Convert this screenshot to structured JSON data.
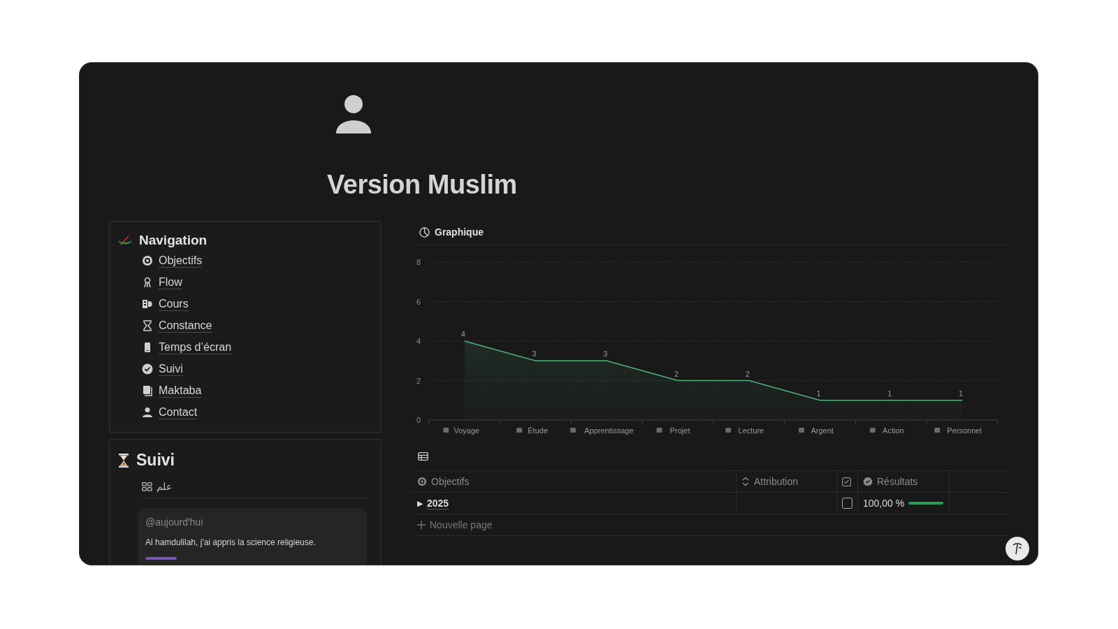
{
  "page": {
    "title": "Version Muslim"
  },
  "navigation": {
    "title": "Navigation",
    "items": [
      {
        "label": "Objectifs"
      },
      {
        "label": "Flow"
      },
      {
        "label": "Cours"
      },
      {
        "label": "Constance"
      },
      {
        "label": "Temps d’écran"
      },
      {
        "label": "Suivi"
      },
      {
        "label": "Maktaba"
      },
      {
        "label": "Contact"
      }
    ]
  },
  "suivi": {
    "title": "Suivi",
    "view_tab": "علم",
    "card": {
      "date": "@aujourd'hui",
      "text": "Al hamdulilah, j'ai appris la science religieuse."
    }
  },
  "chart": {
    "title": "Graphique",
    "chart_data": {
      "type": "area",
      "categories": [
        "Voyage",
        "Étude",
        "Apprentissage",
        "Projet",
        "Lecture",
        "Argent",
        "Action",
        "Personnel"
      ],
      "series": [
        {
          "color": "#4fb27f",
          "values": [
            4,
            3,
            3,
            2,
            2,
            1,
            1,
            1
          ]
        }
      ],
      "ylim": [
        0,
        8
      ],
      "yticks": [
        0,
        2,
        4,
        6,
        8
      ],
      "grid": true,
      "data_labels": true
    }
  },
  "table": {
    "columns": [
      {
        "label": "Objectifs",
        "kind": "title"
      },
      {
        "label": "Attribution",
        "kind": "select"
      },
      {
        "kind": "checkbox"
      },
      {
        "label": "Résultats",
        "kind": "rollup"
      }
    ],
    "rows": [
      {
        "toggle": "▶",
        "title": "2025",
        "expanded": false,
        "checked": false,
        "result": "100,00 %",
        "level": 1
      }
    ],
    "new_row": "Nouvelle page"
  }
}
